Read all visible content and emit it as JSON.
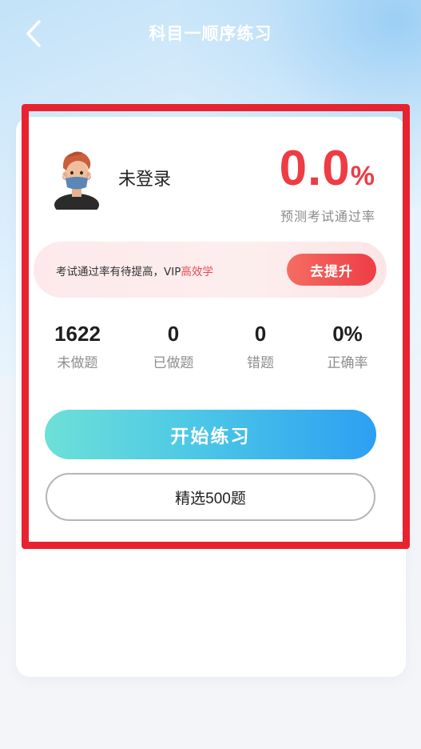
{
  "header": {
    "title": "科目一顺序练习",
    "back_icon": "chevron-left-icon"
  },
  "user": {
    "avatar_icon": "user-avatar-masked-icon",
    "name": "未登录"
  },
  "pass_rate": {
    "value": "0.0",
    "unit": "%",
    "label": "预测考试通过率",
    "color": "#ee3c45"
  },
  "banner": {
    "text": "考试通过率有待提高，VIP",
    "highlight": "高效学",
    "button_label": "去提升"
  },
  "stats": [
    {
      "value": "1622",
      "label": "未做题"
    },
    {
      "value": "0",
      "label": "已做题"
    },
    {
      "value": "0",
      "label": "错题"
    },
    {
      "value": "0%",
      "label": "正确率"
    }
  ],
  "actions": {
    "start_label": "开始练习",
    "select_label": "精选500题"
  },
  "colors": {
    "accent_red": "#e8232f",
    "gradient_start": "#6ee0d8",
    "gradient_end": "#2d9ff2"
  }
}
